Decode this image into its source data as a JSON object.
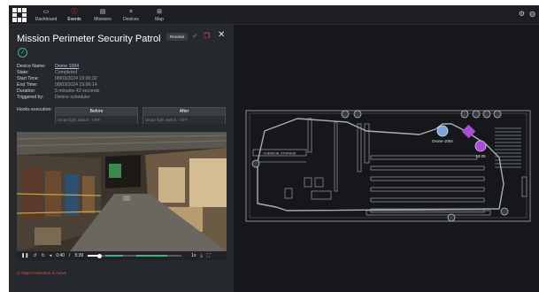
{
  "nav": {
    "items": [
      {
        "label": "Dashboard",
        "icon": "dashboard-icon",
        "glyph": "▭"
      },
      {
        "label": "Events",
        "icon": "alert-icon",
        "glyph": "ⓘ"
      },
      {
        "label": "Missions",
        "icon": "missions-icon",
        "glyph": "▤"
      },
      {
        "label": "Devices",
        "icon": "devices-icon",
        "glyph": "⌗"
      },
      {
        "label": "Map",
        "icon": "map-icon",
        "glyph": "⊞"
      }
    ],
    "active": "Events"
  },
  "event": {
    "title": "Mission Perimeter Security Patrol",
    "resolve_label": "Resolve",
    "details": [
      {
        "label": "Device Name:",
        "value": "Drone 1004",
        "link": true
      },
      {
        "label": "State:",
        "value": "Completed"
      },
      {
        "label": "Start Time:",
        "value": "08/03/2024 19:00:32"
      },
      {
        "label": "End Time:",
        "value": "08/03/2024 19:06:14"
      },
      {
        "label": "Duration:",
        "value": "5 minutes 42 seconds"
      },
      {
        "label": "Triggered by:",
        "value": "Device scheduler"
      }
    ],
    "hooks_label": "Hooks execution:",
    "hooks": {
      "before": {
        "title": "Before",
        "text": "Smart light switch - OFF"
      },
      "after": {
        "title": "After",
        "text": "Smart light switch - OFF"
      }
    }
  },
  "video": {
    "time_current": "0:40",
    "time_separator": "/",
    "time_total": "5:39",
    "progress": 0.13,
    "speed": "1x"
  },
  "detection_label": "Object Detection is Active",
  "map": {
    "area_label": "CHEMICAL STORAGE",
    "drone_label": "Drone 1004",
    "time_marker": "19:05"
  },
  "colors": {
    "accent_red": "#ff5a4d",
    "success_green": "#3fb37f",
    "path": "#8a8f96",
    "drone": "#7aa6d6",
    "marker": "#a64fd1"
  }
}
